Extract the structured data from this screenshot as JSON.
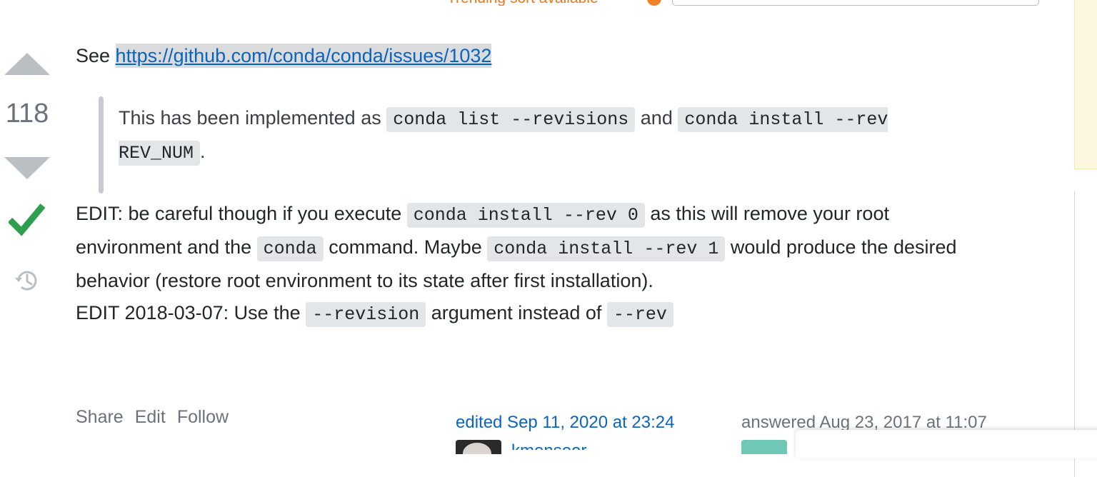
{
  "top": {
    "trending_text": "Trending sort available"
  },
  "votes": {
    "count": "118"
  },
  "answer": {
    "see_prefix": "See ",
    "link_text": "https://github.com/conda/conda/issues/1032",
    "quote": {
      "text1": "This has been implemented as ",
      "code1": "conda list --revisions",
      "text2": " and ",
      "code2": "conda install --rev REV_NUM",
      "text3": "."
    },
    "edit1": {
      "text1": "EDIT: be careful though if you execute ",
      "code1": "conda install --rev 0",
      "text2": " as this will remove your root environment and the ",
      "code2": "conda",
      "text3": " command. Maybe ",
      "code3": "conda install --rev 1",
      "text4": " would produce the desired behavior (restore root environment to its state after first installation)."
    },
    "edit2": {
      "text1": "EDIT 2018-03-07: Use the ",
      "code1": "--revision",
      "text2": " argument instead of ",
      "code2": "--rev"
    }
  },
  "menu": {
    "share": "Share",
    "edit": "Edit",
    "follow": "Follow"
  },
  "signatures": {
    "edited": "edited Sep 11, 2020 at 23:24",
    "editor_name": "kmonsoor",
    "answered": "answered Aug 23, 2017 at 11:07"
  },
  "colors": {
    "link": "#0a64c2",
    "accepted": "#2f9e4e",
    "trending": "#e87922"
  }
}
